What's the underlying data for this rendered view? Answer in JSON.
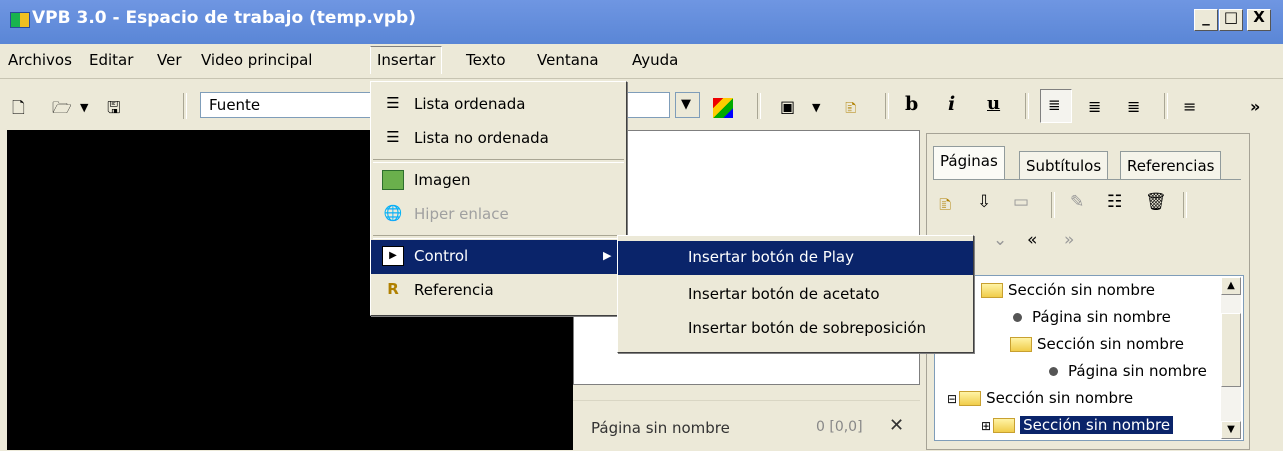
{
  "window": {
    "title": "VPB 3.0 - Espacio de trabajo (temp.vpb)",
    "buttons": [
      "_",
      "□",
      "X"
    ]
  },
  "menubar": {
    "items": [
      "Archivos",
      "Editar",
      "Ver",
      "Video principal",
      "Insertar",
      "Texto",
      "Ventana",
      "Ayuda"
    ],
    "open_item": "Insertar"
  },
  "toolbar": {
    "font_value": "Fuente",
    "bold": "b",
    "italic": "i",
    "underline": "u",
    "more": "»"
  },
  "insert_menu": {
    "items": [
      {
        "label": "Lista ordenada",
        "icon": "ordered-list-icon",
        "enabled": true
      },
      {
        "label": "Lista no ordenada",
        "icon": "unordered-list-icon",
        "enabled": true
      },
      {
        "label": "Imagen",
        "icon": "image-icon",
        "enabled": true
      },
      {
        "label": "Hiper enlace",
        "icon": "hyperlink-icon",
        "enabled": false
      },
      {
        "label": "Control",
        "icon": "control-icon",
        "enabled": true,
        "has_submenu": true
      },
      {
        "label": "Referencia",
        "icon": "reference-icon",
        "enabled": true
      }
    ],
    "highlighted": "Control"
  },
  "control_submenu": {
    "items": [
      "Insertar botón de Play",
      "Insertar botón de acetato",
      "Insertar botón de sobreposición"
    ],
    "highlighted": "Insertar botón de Play"
  },
  "editor_status": {
    "page": "Página sin nombre",
    "coords": "0 [0,0]",
    "close": "✕"
  },
  "right_panel": {
    "tabs": [
      "Páginas",
      "Subtítulos",
      "Referencias"
    ],
    "active_tab": "Páginas",
    "tree": [
      {
        "label": "Sección sin nombre",
        "type": "section"
      },
      {
        "label": "Página sin nombre",
        "type": "page"
      },
      {
        "label": "Sección sin nombre",
        "type": "section"
      },
      {
        "label": "Página sin nombre",
        "type": "page"
      },
      {
        "label": "Sección sin nombre",
        "type": "section"
      },
      {
        "label": "Sección sin nombre",
        "type": "section",
        "selected": true
      }
    ]
  },
  "colors": {
    "titlebar": "#5a86d6",
    "highlight": "#0a246a",
    "face": "#ece9d8"
  }
}
